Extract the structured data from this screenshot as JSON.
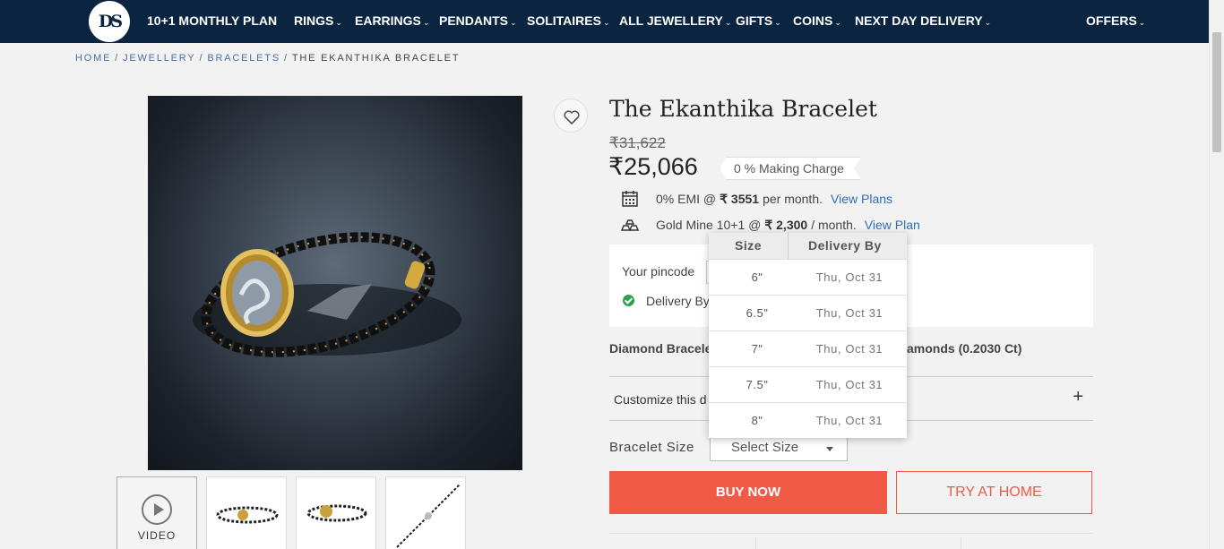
{
  "nav": {
    "logo": "DS",
    "items": [
      {
        "label": "10+1 MONTHLY PLAN",
        "dropdown": false
      },
      {
        "label": "RINGS",
        "dropdown": true
      },
      {
        "label": "EARRINGS",
        "dropdown": true
      },
      {
        "label": "PENDANTS",
        "dropdown": true
      },
      {
        "label": "SOLITAIRES",
        "dropdown": true
      },
      {
        "label": "ALL JEWELLERY",
        "dropdown": true
      },
      {
        "label": "GIFTS",
        "dropdown": true
      },
      {
        "label": "COINS",
        "dropdown": true
      },
      {
        "label": "NEXT DAY DELIVERY",
        "dropdown": true
      },
      {
        "label": "OFFERS",
        "dropdown": true
      }
    ],
    "chevron": "⌄"
  },
  "breadcrumb": {
    "home": "HOME",
    "jewellery": "JEWELLERY",
    "bracelets": "BRACELETS",
    "current": "THE EKANTHIKA BRACELET",
    "separator": "/"
  },
  "gallery": {
    "video_label": "VIDEO"
  },
  "product": {
    "title": "The Ekanthika Bracelet",
    "mrp": "₹31,622",
    "price": "₹25,066",
    "making_charge": "0 % Making Charge"
  },
  "emi": {
    "prefix": "0% EMI @",
    "amount": "₹ 3551",
    "suffix": "per month.",
    "link": "View Plans",
    "icon": "calendar-icon"
  },
  "gold_mine": {
    "prefix": "Gold Mine 10+1 @",
    "amount": "₹ 2,300",
    "suffix": "/ month.",
    "link": "View Plan",
    "icon": "gold-bars-icon"
  },
  "pincode": {
    "label": "Your pincode",
    "delivery_text": "Delivery By"
  },
  "details": {
    "diamond_left": "Diamond Bracele",
    "diamond_right": "amonds (0.2030 Ct)"
  },
  "customize": {
    "label": "Customize this d",
    "plus": "+"
  },
  "size": {
    "label": "Bracelet Size",
    "placeholder": "Select Size"
  },
  "actions": {
    "buy": "BUY NOW",
    "try": "TRY AT HOME"
  },
  "size_popover": {
    "headers": {
      "size": "Size",
      "delivery": "Delivery By"
    },
    "rows": [
      {
        "size": "6\"",
        "date": "Thu, Oct 31"
      },
      {
        "size": "6.5\"",
        "date": "Thu, Oct 31"
      },
      {
        "size": "7\"",
        "date": "Thu, Oct 31"
      },
      {
        "size": "7.5\"",
        "date": "Thu, Oct 31"
      },
      {
        "size": "8\"",
        "date": "Thu, Oct 31"
      }
    ]
  },
  "colors": {
    "nav_bg": "#0b2540",
    "accent": "#f05a46",
    "link": "#2f6fb7",
    "success": "#2ca24f"
  }
}
